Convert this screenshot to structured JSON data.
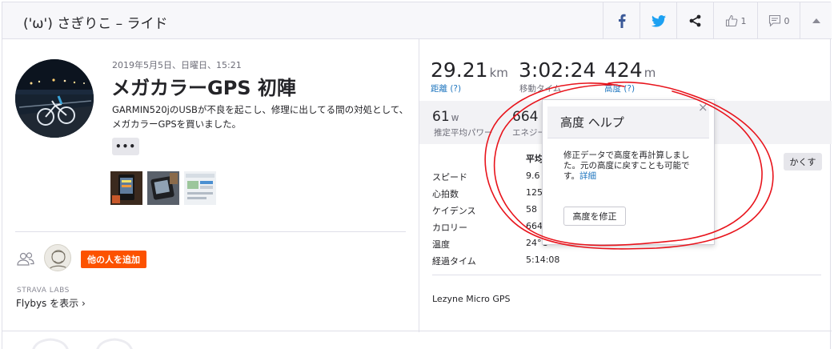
{
  "header": {
    "title": "('ω') さぎりこ – ライド",
    "kudos_count": "1",
    "comment_count": "0"
  },
  "activity": {
    "date": "2019年5月5日、日曜日、15:21",
    "title": "メガカラーGPS 初陣",
    "description": "GARMIN520jのUSBが不良を起こし、修理に出してる間の対処として、メガカラーGPSを買いました。",
    "more_label": "•••"
  },
  "social": {
    "add_others_label": "他の人を追加",
    "labs_label": "STRAVA LABS",
    "flybys_label": "Flybys を表示 ›"
  },
  "stats": {
    "distance": {
      "value": "29.21",
      "unit": "km",
      "label": "距離 (?)"
    },
    "moving_time": {
      "value": "3:02:24",
      "label": "移動タイム"
    },
    "elevation": {
      "value": "424",
      "unit": "m",
      "label": "高度 (?)"
    },
    "avg_power": {
      "value": "61",
      "unit": "w",
      "label": "推定平均パワー"
    },
    "energy": {
      "value": "664",
      "label": "エネジー"
    }
  },
  "details": {
    "column_header": "平均",
    "rows": [
      {
        "label": "スピード",
        "value": "9.6"
      },
      {
        "label": "心拍数",
        "value": "125"
      },
      {
        "label": "ケイデンス",
        "value": "58"
      },
      {
        "label": "カロリー",
        "value": "664"
      },
      {
        "label": "温度",
        "value": "24°C"
      },
      {
        "label": "経過タイム",
        "value": "5:14:08"
      }
    ],
    "hide_label": "かくす",
    "device": "Lezyne Micro GPS"
  },
  "popover": {
    "title": "高度 ヘルプ",
    "close": "×",
    "body": "修正データで高度を再計算しました。元の高度に戻すことも可能です。",
    "link": "詳細",
    "button": "高度を修正"
  },
  "colors": {
    "accent_orange": "#fc5200",
    "link_blue": "#1f76bf",
    "facebook": "#3b5998",
    "twitter": "#1da1f2",
    "annotation_red": "#e8141c"
  }
}
